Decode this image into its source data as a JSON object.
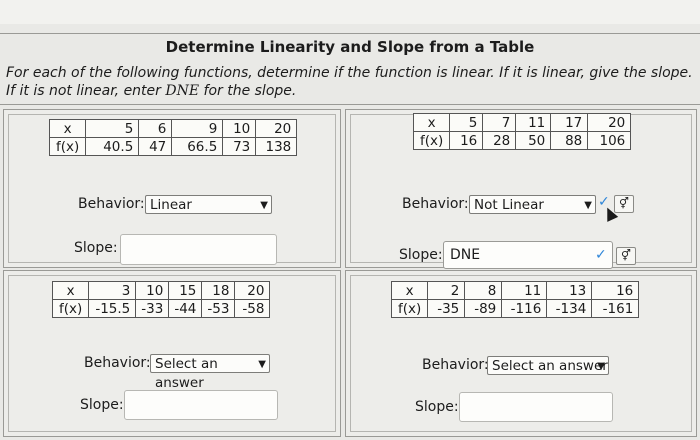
{
  "page": {
    "title": "Determine Linearity and Slope from a Table",
    "instructions_pre": "For each of the following functions, determine if the function is linear. If it is linear, give the slope. If it is not linear, enter ",
    "instructions_dne": "DNE",
    "instructions_post": " for the slope."
  },
  "problems": [
    {
      "x_label": "x",
      "fx_label": "f(x)",
      "x": [
        "5",
        "6",
        "9",
        "10",
        "20"
      ],
      "fx": [
        "40.5",
        "47",
        "66.5",
        "73",
        "138"
      ],
      "behavior_label": "Behavior:",
      "behavior_value": "Linear",
      "slope_label": "Slope:",
      "slope_value": ""
    },
    {
      "x_label": "x",
      "fx_label": "f(x)",
      "x": [
        "5",
        "7",
        "11",
        "17",
        "20"
      ],
      "fx": [
        "16",
        "28",
        "50",
        "88",
        "106"
      ],
      "behavior_label": "Behavior:",
      "behavior_value": "Not Linear",
      "slope_label": "Slope:",
      "slope_value": "DNE"
    },
    {
      "x_label": "x",
      "fx_label": "f(x)",
      "x": [
        "3",
        "10",
        "15",
        "18",
        "20"
      ],
      "fx": [
        "-15.5",
        "-33",
        "-44",
        "-53",
        "-58"
      ],
      "behavior_label": "Behavior:",
      "behavior_value": "Select an answer",
      "slope_label": "Slope:",
      "slope_value": ""
    },
    {
      "x_label": "x",
      "fx_label": "f(x)",
      "x": [
        "2",
        "8",
        "11",
        "13",
        "16"
      ],
      "fx": [
        "-35",
        "-89",
        "-116",
        "-134",
        "-161"
      ],
      "behavior_label": "Behavior:",
      "behavior_value": "Select an answer",
      "slope_label": "Slope:",
      "slope_value": ""
    }
  ],
  "icons": {
    "dropdown_arrow": "chevron-down-icon",
    "correct": "checkmark-icon",
    "preview": "gender-symbol-icon",
    "cursor": "mouse-pointer-icon"
  },
  "colors": {
    "check": "#2f86d8",
    "background": "#e9e9e6"
  }
}
